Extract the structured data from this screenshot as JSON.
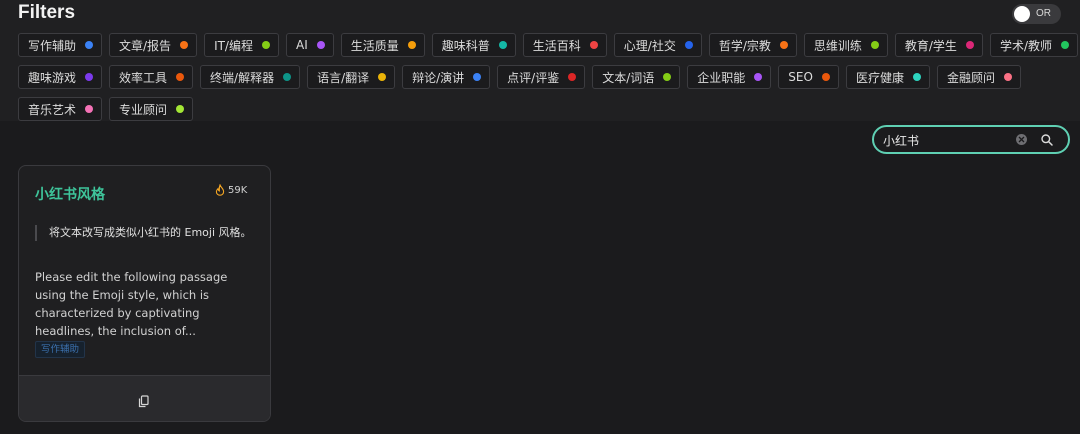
{
  "filters": {
    "title": "Filters",
    "toggle_label": "OR",
    "tag_rows": [
      [
        {
          "label": "写作辅助",
          "color": "#3b82f6"
        },
        {
          "label": "文章/报告",
          "color": "#f97316"
        },
        {
          "label": "IT/编程",
          "color": "#84cc16"
        },
        {
          "label": "AI",
          "color": "#a855f7"
        },
        {
          "label": "生活质量",
          "color": "#f59e0b"
        },
        {
          "label": "趣味科普",
          "color": "#14b8a6"
        },
        {
          "label": "生活百科",
          "color": "#ef4444"
        },
        {
          "label": "心理/社交",
          "color": "#2563eb"
        },
        {
          "label": "哲学/宗教",
          "color": "#f97316"
        },
        {
          "label": "思维训练",
          "color": "#84cc16"
        },
        {
          "label": "教育/学生",
          "color": "#db2777"
        },
        {
          "label": "学术/教师",
          "color": "#22c55e"
        }
      ],
      [
        {
          "label": "趣味游戏",
          "color": "#7c3aed"
        },
        {
          "label": "效率工具",
          "color": "#ea580c"
        },
        {
          "label": "终端/解释器",
          "color": "#0d9488"
        },
        {
          "label": "语言/翻译",
          "color": "#eab308"
        },
        {
          "label": "辩论/演讲",
          "color": "#3b82f6"
        },
        {
          "label": "点评/评鉴",
          "color": "#dc2626"
        },
        {
          "label": "文本/词语",
          "color": "#84cc16"
        },
        {
          "label": "企业职能",
          "color": "#a855f7"
        },
        {
          "label": "SEO",
          "color": "#ea580c"
        },
        {
          "label": "医疗健康",
          "color": "#2dd4bf"
        },
        {
          "label": "金融顾问",
          "color": "#fb7185"
        }
      ],
      [
        {
          "label": "音乐艺术",
          "color": "#f472b6"
        },
        {
          "label": "专业顾问",
          "color": "#a3e635"
        }
      ]
    ]
  },
  "search": {
    "value": "小红书"
  },
  "card": {
    "title": "小红书风格",
    "hot_count": "59K",
    "quote": "将文本改写成类似小红书的 Emoji 风格。",
    "description": "Please edit the following passage using the Emoji style, which is characterized by captivating headlines, the inclusion of...",
    "tag": "写作辅助"
  },
  "icons": {
    "hot": "flame-icon",
    "clear": "clear-icon",
    "search": "search-icon",
    "copy": "copy-icon"
  },
  "colors": {
    "accent": "#3ec49a",
    "search_border": "#5fd0b3",
    "hot_icon": "#f5a623",
    "tag_text": "#3b70ad"
  }
}
